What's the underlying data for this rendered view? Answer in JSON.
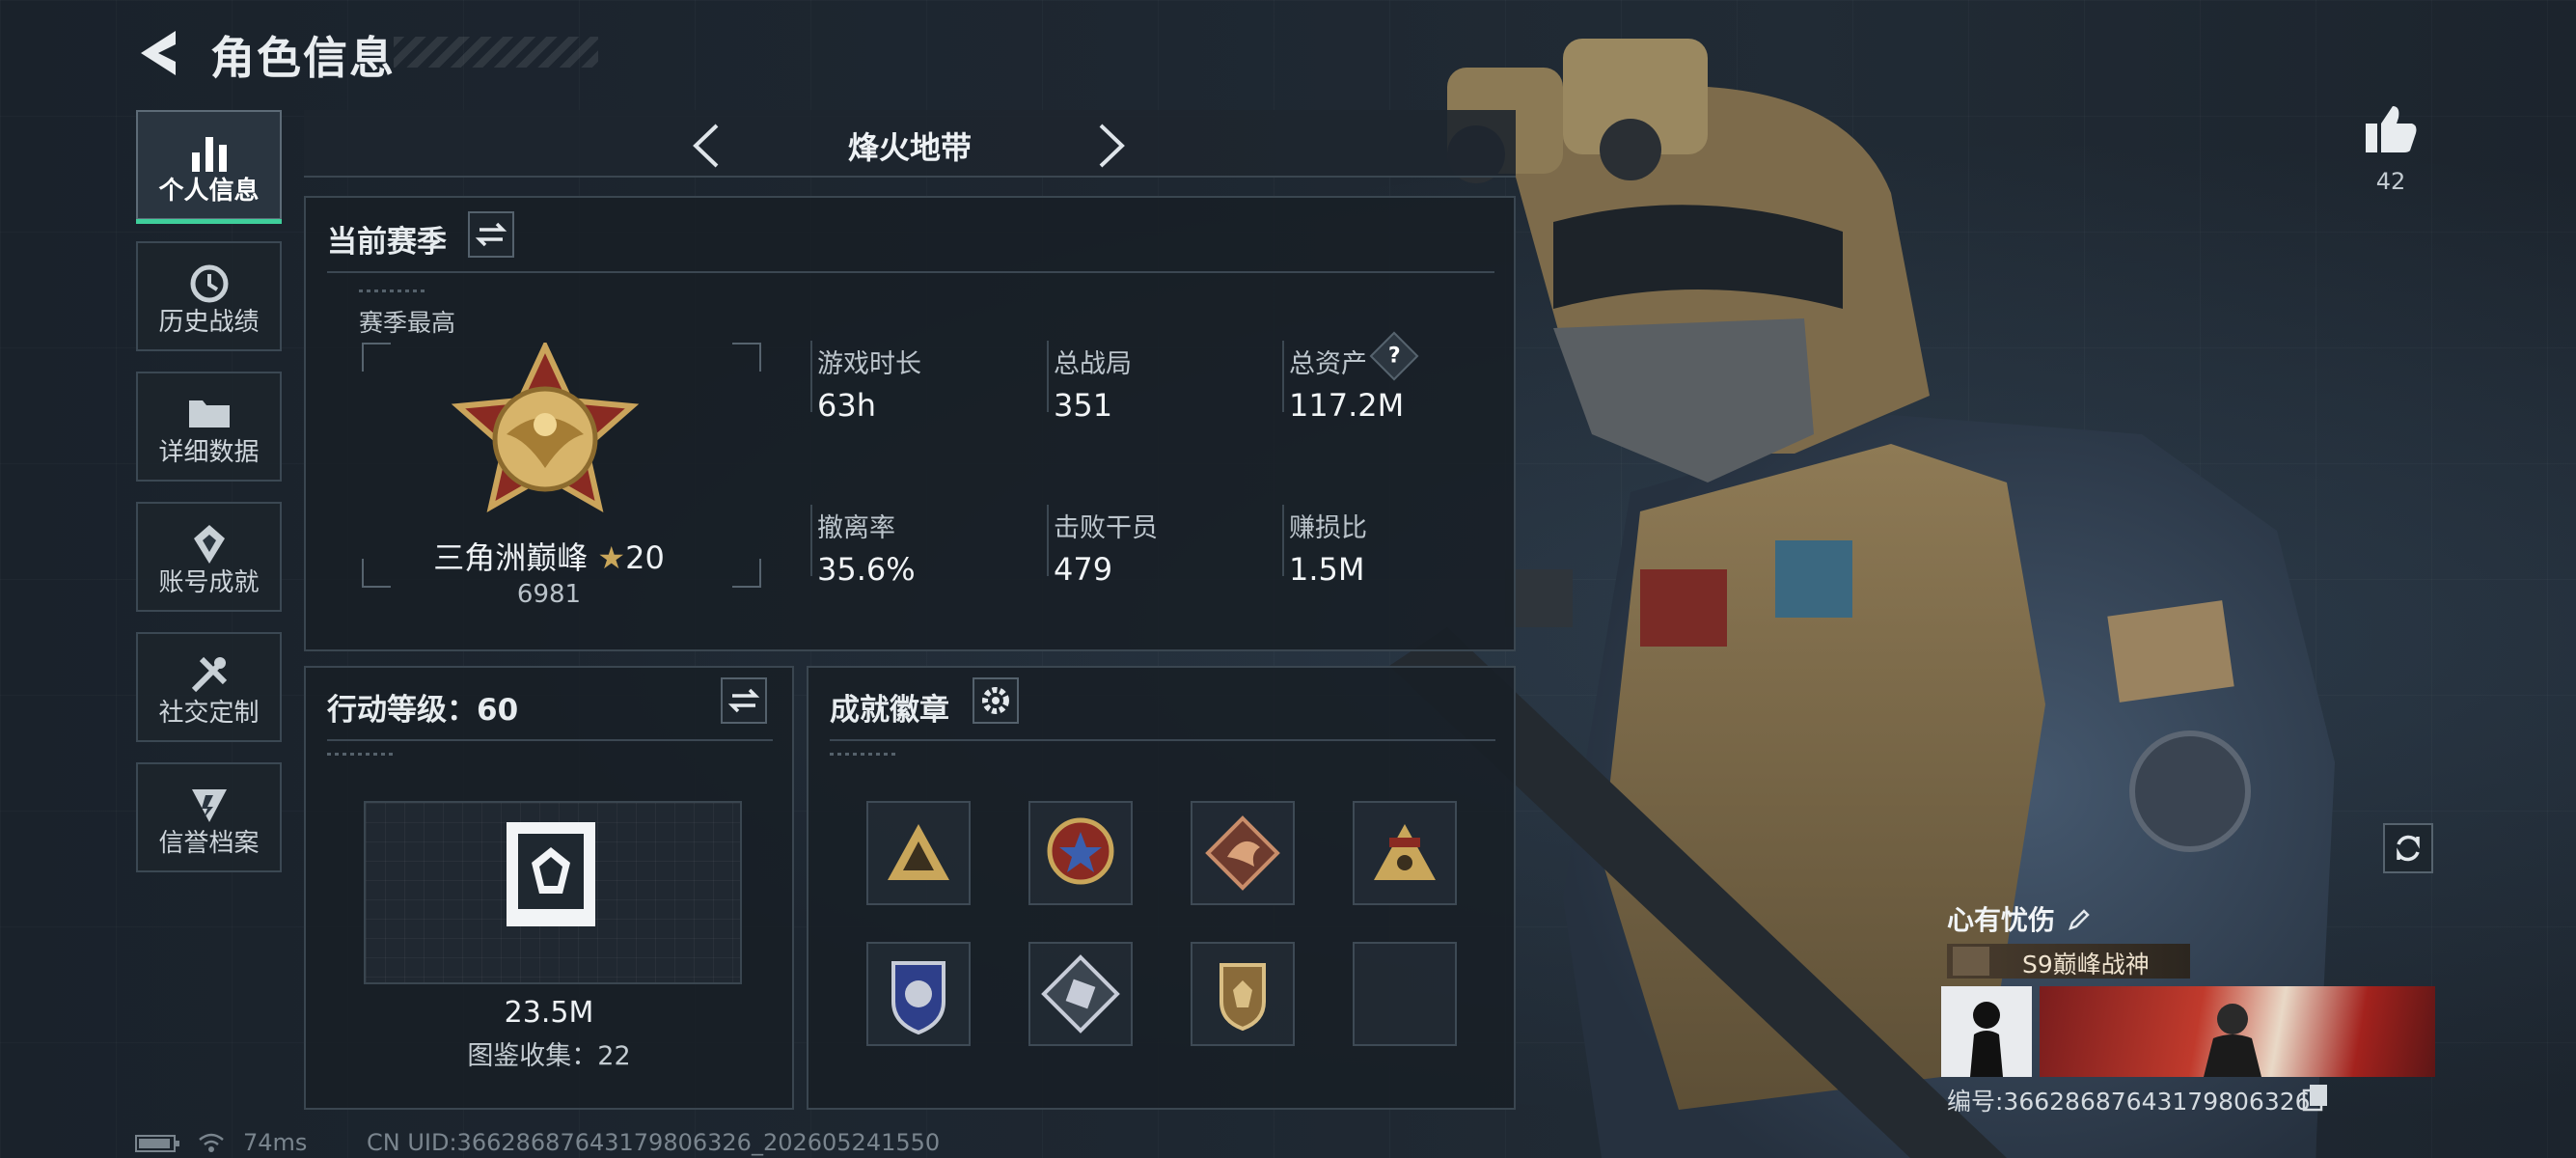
{
  "header": {
    "title": "角色信息"
  },
  "sidebar": {
    "items": [
      {
        "label": "个人信息",
        "icon": "bar-chart-icon",
        "active": true
      },
      {
        "label": "历史战绩",
        "icon": "history-icon",
        "active": false
      },
      {
        "label": "详细数据",
        "icon": "folder-icon",
        "active": false
      },
      {
        "label": "账号成就",
        "icon": "achievement-icon",
        "active": false
      },
      {
        "label": "社交定制",
        "icon": "tools-icon",
        "active": false
      },
      {
        "label": "信誉档案",
        "icon": "reputation-icon",
        "active": false
      }
    ]
  },
  "mode": {
    "name": "烽火地带"
  },
  "season": {
    "title": "当前赛季",
    "best_label": "赛季最高",
    "rank_name": "三角洲巅峰",
    "rank_stars": "20",
    "rank_points": "6981",
    "stats": [
      {
        "label": "游戏时长",
        "value": "63h"
      },
      {
        "label": "总战局",
        "value": "351"
      },
      {
        "label": "总资产",
        "value": "117.2M",
        "help": "?"
      },
      {
        "label": "撤离率",
        "value": "35.6%"
      },
      {
        "label": "击败干员",
        "value": "479"
      },
      {
        "label": "赚损比",
        "value": "1.5M"
      }
    ]
  },
  "action_level": {
    "title": "行动等级：60",
    "value": "23.5M",
    "collection": "图鉴收集：22"
  },
  "badges": {
    "title": "成就徽章",
    "slots": 8
  },
  "likes": {
    "count": "42"
  },
  "profile": {
    "nickname": "心有忧伤",
    "tag": "S9巅峰战神",
    "id_text": "编号:3662868764317980​6326"
  },
  "footer": {
    "ping": "74ms",
    "uid": "CN UID:3662868764317980​6326_202605241550"
  },
  "colors": {
    "accent": "#3fcf9b",
    "gold": "#c9a65a"
  }
}
